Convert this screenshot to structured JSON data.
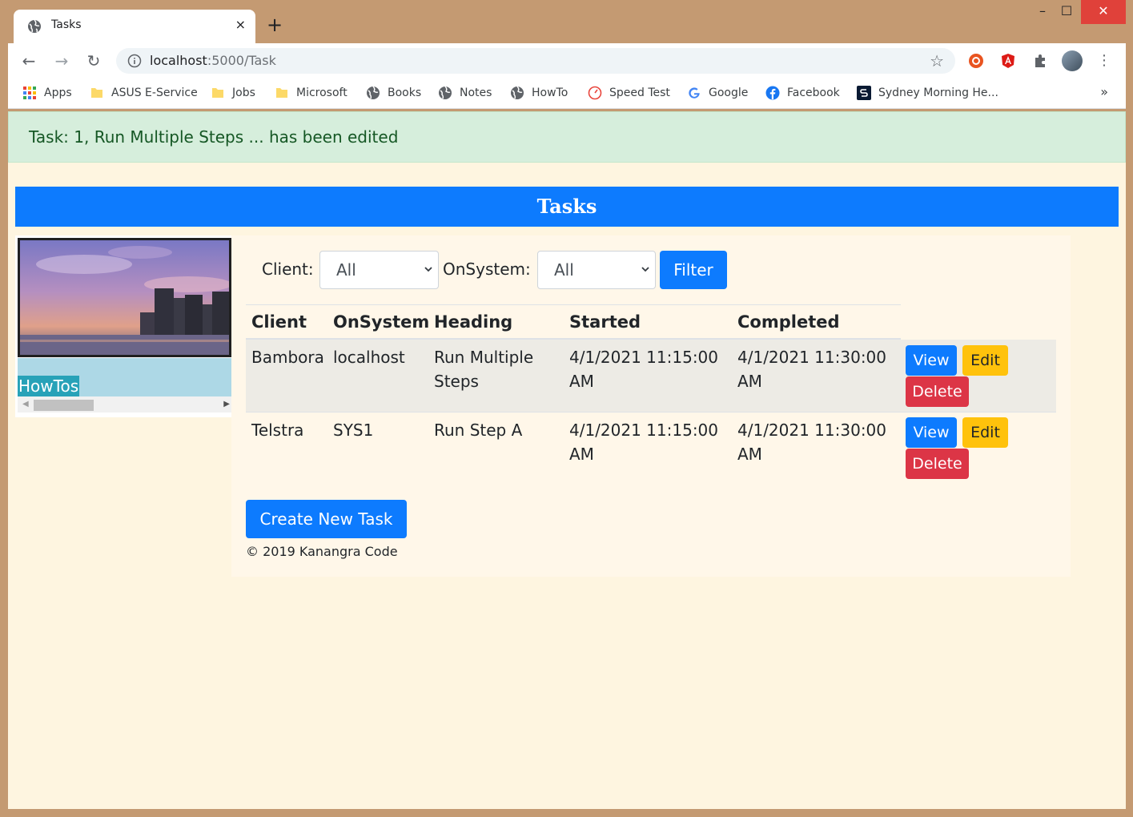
{
  "browser": {
    "tab_title": "Tasks",
    "tab_close": "×",
    "new_tab": "+",
    "window_minimize": "–",
    "window_maximize": "☐",
    "window_close": "✕",
    "url_host": "localhost",
    "url_path": ":5000/Task",
    "bookmarks": [
      {
        "label": "Apps",
        "icon": "apps-grid-icon"
      },
      {
        "label": "ASUS E-Service",
        "icon": "folder-icon"
      },
      {
        "label": "Jobs",
        "icon": "folder-icon"
      },
      {
        "label": "Microsoft",
        "icon": "folder-icon"
      },
      {
        "label": "Books",
        "icon": "globe-icon"
      },
      {
        "label": "Notes",
        "icon": "globe-icon"
      },
      {
        "label": "HowTo",
        "icon": "globe-icon"
      },
      {
        "label": "Speed Test",
        "icon": "speedometer-icon"
      },
      {
        "label": "Google",
        "icon": "google-icon"
      },
      {
        "label": "Facebook",
        "icon": "facebook-icon"
      },
      {
        "label": "Sydney Morning He...",
        "icon": "smh-icon"
      }
    ],
    "bookmarks_more": "»"
  },
  "alert": {
    "message": "Task: 1, Run Multiple Steps ... has been edited"
  },
  "header": {
    "title": "Tasks"
  },
  "sidebar": {
    "link_label": "HowTos"
  },
  "filter": {
    "client_label": "Client:",
    "client_value": "All",
    "onsystem_label": "OnSystem:",
    "onsystem_value": "All",
    "button_label": "Filter"
  },
  "table": {
    "columns": [
      "Client",
      "OnSystem",
      "Heading",
      "Started",
      "Completed"
    ],
    "rows": [
      {
        "client": "Bambora",
        "onsystem": "localhost",
        "heading_line1": "Run Multiple",
        "heading_line2": "Steps",
        "started_line1": "4/1/2021 11:15:00",
        "started_line2": "AM",
        "completed_line1": "4/1/2021 11:30:00",
        "completed_line2": "AM"
      },
      {
        "client": "Telstra",
        "onsystem": "SYS1",
        "heading_line1": "Run Step A",
        "heading_line2": "",
        "started_line1": "4/1/2021 11:15:00",
        "started_line2": "AM",
        "completed_line1": "4/1/2021 11:30:00",
        "completed_line2": "AM"
      }
    ],
    "actions": {
      "view": "View",
      "edit": "Edit",
      "delete": "Delete"
    }
  },
  "create_button": "Create New Task",
  "footer": "© 2019 Kanangra Code",
  "colors": {
    "primary": "#0d7bfe",
    "warning": "#ffc20c",
    "danger": "#dc3546",
    "alert_bg": "#d6eedc",
    "page_bg": "#fef5e0"
  }
}
